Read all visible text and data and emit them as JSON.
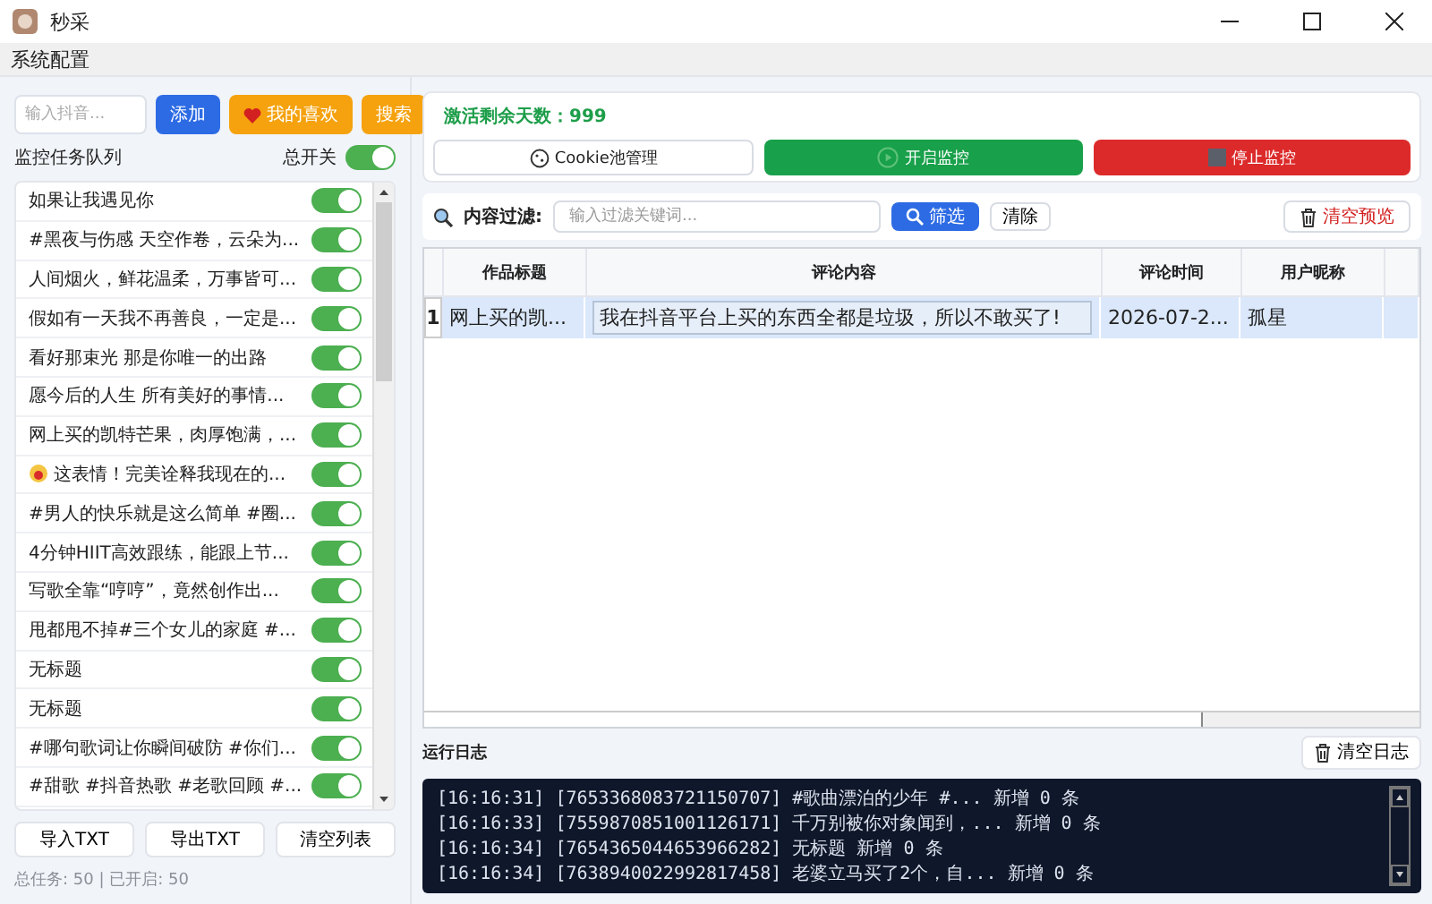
{
  "window": {
    "title": "秒采"
  },
  "menu": [
    {
      "label": "系统配置"
    }
  ],
  "left": {
    "input_placeholder": "输入抖音...",
    "buttons": [
      {
        "label": "添加",
        "kind": "primary"
      },
      {
        "label": "我的喜欢",
        "kind": "favorite"
      },
      {
        "label": "搜索",
        "kind": "warning"
      }
    ],
    "queue_label": "监控任务队列",
    "master_switch": {
      "label": "总开关",
      "on": true
    },
    "tasks": [
      {
        "title": "如果让我遇见你",
        "kind": "text",
        "on": true
      },
      {
        "title": "#黑夜与伤感 天空作卷，云朵为...",
        "kind": "text",
        "on": true
      },
      {
        "title": "人间烟火，鲜花温柔，万事皆可...",
        "kind": "text",
        "on": true
      },
      {
        "title": "假如有一天我不再善良，一定是...",
        "kind": "text",
        "on": true
      },
      {
        "title": "看好那束光 那是你唯一的出路",
        "kind": "text",
        "on": true
      },
      {
        "title": "愿今后的人生 所有美好的事情...",
        "kind": "text",
        "on": true
      },
      {
        "title": "网上买的凯特芒果，肉厚饱满，...",
        "kind": "text",
        "on": true
      },
      {
        "title": "这表情！完美诠释我现在的...",
        "kind": "emoji",
        "on": true
      },
      {
        "title": "#男人的快乐就是这么简单 #圈...",
        "kind": "text",
        "on": true
      },
      {
        "title": "4分钟HIIT高效跟练，能跟上节...",
        "kind": "text",
        "on": true
      },
      {
        "title": "写歌全靠“哼哼”，竟然创作出...",
        "kind": "text",
        "on": true
      },
      {
        "title": "甩都甩不掉#三个女儿的家庭 #...",
        "kind": "text",
        "on": true
      },
      {
        "title": "无标题",
        "kind": "text",
        "on": true
      },
      {
        "title": "无标题",
        "kind": "text",
        "on": true
      },
      {
        "title": "#哪句歌词让你瞬间破防 #你们...",
        "kind": "text",
        "on": true
      },
      {
        "title": "#甜歌 #抖音热歌 #老歌回顾 #...",
        "kind": "text",
        "on": true
      }
    ],
    "actions": [
      "导入TXT",
      "导出TXT",
      "清空列表"
    ],
    "summary": "总任务: 50 | 已开启: 50"
  },
  "activation": "激活剩余天数：999",
  "controls": [
    {
      "label": "Cookie池管理",
      "kind": "cookie"
    },
    {
      "label": "开启监控",
      "kind": "start"
    },
    {
      "label": "停止监控",
      "kind": "stop"
    }
  ],
  "filter": {
    "label": "内容过滤:",
    "placeholder": "输入过滤关键词...",
    "filter_button": "筛选",
    "clear_button": "清除",
    "clear_preview": "清空预览"
  },
  "table": {
    "columns": [
      "作品标题",
      "评论内容",
      "评论时间",
      "用户昵称"
    ],
    "rows": [
      {
        "index": "1",
        "selected": true,
        "cells": [
          "网上买的凯...",
          "我在抖音平台上买的东西全都是垃圾，所以不敢买了!",
          "2026-07-2...",
          "孤星"
        ]
      }
    ]
  },
  "log": {
    "title": "运行日志",
    "clear_button": "清空日志",
    "lines": [
      "[16:16:31] [7653368083721150707] #歌曲漂泊的少年 #... 新增 0 条",
      "[16:16:33] [7559870851001126171] 千万别被你对象闻到，... 新增 0 条",
      "[16:16:34] [7654365044653966282] 无标题 新增 0 条",
      "[16:16:34] [7638940022992817458] 老婆立马买了2个，自... 新增 0 条"
    ]
  }
}
